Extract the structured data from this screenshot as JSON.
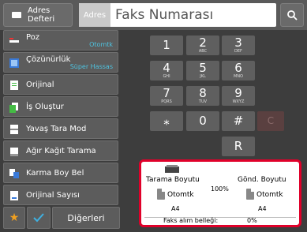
{
  "header": {
    "address_book_label": "Adres\nDefteri",
    "address_chip": "Adres",
    "fax_number_placeholder": "Faks Numarası"
  },
  "sidebar": {
    "items": [
      {
        "label": "Poz",
        "value": "Otomtk",
        "icon": "exposure-icon"
      },
      {
        "label": "Çözünürlük",
        "value": "Süper Hassas",
        "icon": "resolution-icon"
      },
      {
        "label": "Orijinal",
        "value": "",
        "icon": "original-icon"
      },
      {
        "label": "İş Oluştur",
        "value": "",
        "icon": "job-build-icon"
      },
      {
        "label": "Yavaş Tara Mod",
        "value": "",
        "icon": "slow-scan-icon"
      },
      {
        "label": "Ağır Kağıt Tarama",
        "value": "",
        "icon": "thick-paper-icon"
      },
      {
        "label": "Karma Boy Bel",
        "value": "",
        "icon": "mixed-size-icon"
      },
      {
        "label": "Orijinal Sayısı",
        "value": "",
        "icon": "original-count-icon"
      }
    ],
    "others_label": "Diğerleri"
  },
  "keypad": {
    "keys": [
      {
        "num": "1",
        "letters": ""
      },
      {
        "num": "2",
        "letters": "ABC"
      },
      {
        "num": "3",
        "letters": "DEF"
      },
      {
        "num": "4",
        "letters": "GHI"
      },
      {
        "num": "5",
        "letters": "JKL"
      },
      {
        "num": "6",
        "letters": "MNO"
      },
      {
        "num": "7",
        "letters": "PQRS"
      },
      {
        "num": "8",
        "letters": "TUV"
      },
      {
        "num": "9",
        "letters": "WXYZ"
      },
      {
        "num": "⁎",
        "letters": ""
      },
      {
        "num": "0",
        "letters": ""
      },
      {
        "num": "#",
        "letters": ""
      }
    ],
    "clear_label": "C",
    "r_label": "R"
  },
  "info": {
    "scan_size_label": "Tarama Boyutu",
    "send_size_label": "Gönd. Boyutu",
    "scan_mode": "Otomtk",
    "send_mode": "Otomtk",
    "ratio": "100%",
    "scan_paper": "A4",
    "send_paper": "A4",
    "memory_label": "Faks alım belleği:",
    "memory_value": "0%"
  },
  "colors": {
    "accent_red": "#e0002a",
    "sub_value": "#4ec3e0",
    "star": "#f0a020"
  }
}
